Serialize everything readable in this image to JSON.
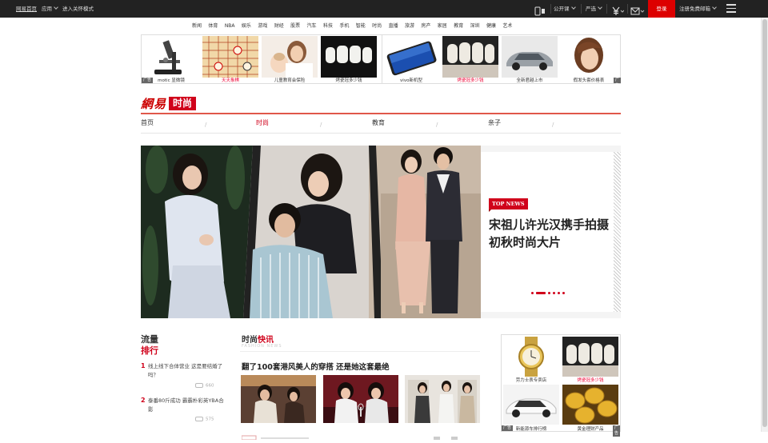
{
  "topbar": {
    "home": "网易首页",
    "apps": "应用",
    "care_mode": "进入关怀模式",
    "public_class": "公开课",
    "yanxuan": "严选",
    "login": "登录",
    "register_mail": "注册免费邮箱"
  },
  "channels": [
    "新闻",
    "体育",
    "NBA",
    "娱乐",
    "游戏",
    "财经",
    "股票",
    "汽车",
    "科技",
    "手机",
    "智能",
    "时尚",
    "直播",
    "旅游",
    "房产",
    "家居",
    "教育",
    "深圳",
    "健康",
    "艺术"
  ],
  "ads": [
    {
      "caption": "motic 显微镜",
      "red": false
    },
    {
      "caption": "天天象棋",
      "red": true
    },
    {
      "caption": "儿童教育会保险",
      "red": false
    },
    {
      "caption": "烤瓷冠多少钱",
      "red": false
    },
    {
      "caption": "vivo新机型",
      "red": false
    },
    {
      "caption": "烤瓷冠多少钱",
      "red": true
    },
    {
      "caption": "全新君越上市",
      "red": false
    },
    {
      "caption": "假发头套价格表",
      "red": false
    }
  ],
  "ad_badge": "广告",
  "logo": {
    "wangyi": "網易",
    "section": "时尚"
  },
  "subnav": [
    {
      "label": "首页",
      "active": false
    },
    {
      "label": "时尚",
      "active": true
    },
    {
      "label": "教育",
      "active": false
    },
    {
      "label": "亲子",
      "active": false
    }
  ],
  "subnav_sep": "/",
  "hero": {
    "tag": "TOP NEWS",
    "title": "宋祖儿许光汉携手拍摄初秋时尚大片",
    "slide_count": 6,
    "active_slide": 1
  },
  "ranking": {
    "title1": "流量",
    "title2": "排行",
    "items": [
      {
        "num": "1",
        "text": "线上线下合体营业 这是要结婚了吗？",
        "count": "660"
      },
      {
        "num": "2",
        "text": "泰番80斤成功 霸霸朴彩英YBA合影",
        "count": "575"
      }
    ]
  },
  "newsflash": {
    "title_a": "时尚",
    "title_b": "快讯",
    "en": "FASHION NEWS",
    "headline": "翻了100套港风美人的穿搭 还是她这套最绝"
  },
  "right_ads": [
    {
      "caption": "劳力士表专卖店",
      "red": false
    },
    {
      "caption": "烤瓷冠多少钱",
      "red": true
    },
    {
      "caption": "新能源车排行榜",
      "red": false
    },
    {
      "caption": "黄金理财产品",
      "red": false
    }
  ],
  "colors": {
    "brand_red": "#d0021b",
    "topbar": "#222222"
  }
}
